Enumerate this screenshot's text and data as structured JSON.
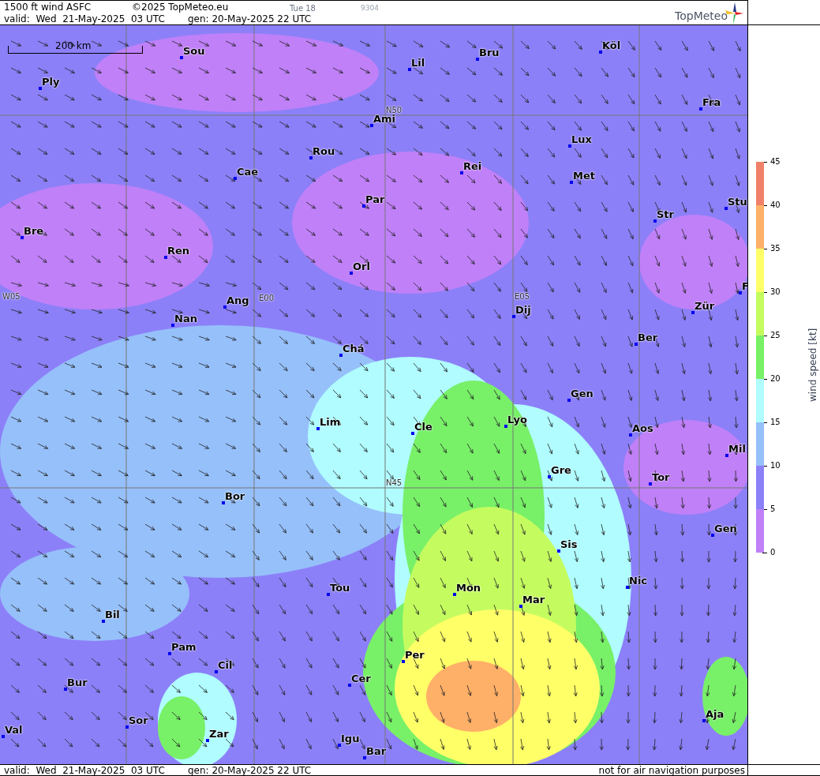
{
  "header": {
    "product": "1500 ft wind ASFC",
    "copyright": "©2025 TopMeteo.eu",
    "day": "Tue 18",
    "code": "9304",
    "valid": "valid:  Wed  21-May-2025  03 UTC",
    "gen": "gen: 20-May-2025 22 UTC",
    "logo": "TopMeteo"
  },
  "map": {
    "scale": "200 km",
    "grid_labels": [
      "N50",
      "W05",
      "E00",
      "E05",
      "N45"
    ],
    "cities": [
      "Sou",
      "Bru",
      "Köl",
      "Ply",
      "Lil",
      "Ami",
      "Fra",
      "Lux",
      "Rou",
      "Cae",
      "Rei",
      "Met",
      "Par",
      "Stu",
      "Str",
      "Bre",
      "Ren",
      "Orl",
      "Ang",
      "Nan",
      "Dij",
      "Zür",
      "Ber",
      "Chá",
      "Gen",
      "Lim",
      "Cle",
      "Lyo",
      "Aos",
      "Mil",
      "Gre",
      "Tor",
      "Bor",
      "Gen",
      "Sis",
      "Nic",
      "Tou",
      "Mon",
      "Mar",
      "Bil",
      "Pam",
      "Cil",
      "Per",
      "Cer",
      "Bur",
      "Sor",
      "Aja",
      "Val",
      "Zar",
      "Igu",
      "Bar",
      "F"
    ]
  },
  "legend": {
    "title": "wind speed [kt]",
    "ticks": [
      "45",
      "40",
      "35",
      "30",
      "25",
      "20",
      "15",
      "10",
      "5",
      "0"
    ],
    "bands": [
      {
        "color": "#f08068"
      },
      {
        "color": "#ffb068"
      },
      {
        "color": "#ffff68"
      },
      {
        "color": "#c4fc60"
      },
      {
        "color": "#78f068"
      },
      {
        "color": "#b0fcff"
      },
      {
        "color": "#96c0fa"
      },
      {
        "color": "#8c80f8"
      },
      {
        "color": "#c080f8"
      }
    ]
  },
  "footer": {
    "valid": "valid:  Wed  21-May-2025  03 UTC",
    "gen": "gen: 20-May-2025 22 UTC",
    "disclaimer": "not for air navigation purposes"
  }
}
